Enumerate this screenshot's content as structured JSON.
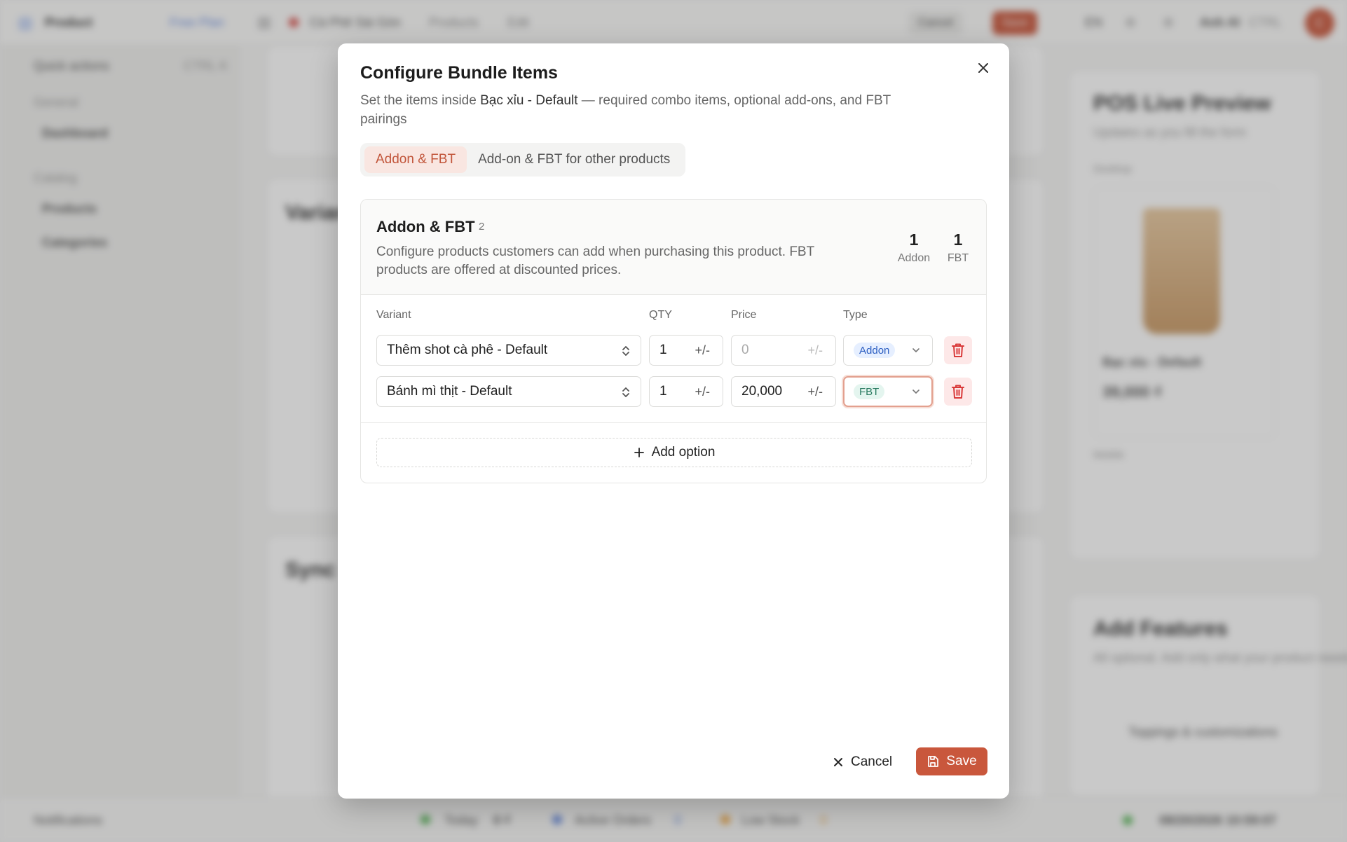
{
  "background": {
    "app_name": "Product",
    "plan_label": "Free Plan",
    "quick_actions": "Quick actions",
    "quick_shortcut": "CTRL K",
    "nav_section_general": "General",
    "nav_dashboard": "Dashboard",
    "nav_section_catalog": "Catalog",
    "nav_products": "Products",
    "nav_categories": "Categories",
    "breadcrumb_store": "Cà Phê Sài Gòn",
    "breadcrumb_products": "Products",
    "breadcrumb_edit": "Edit",
    "cancel_label": "Cancel",
    "save_label": "Save",
    "lang_label": "EN",
    "user_label": "Anh Al",
    "user_shortcut": "CTRL",
    "avatar_initial": "C",
    "variants_title": "Variants",
    "sync_title": "Sync",
    "preview_title": "POS Live Preview",
    "preview_subtitle": "Updates as you fill the form",
    "preview_desktop": "Desktop",
    "preview_item_name": "Bạc xỉu - Default",
    "preview_item_price": "39,000 ₫",
    "preview_mobile": "Mobile",
    "add_features_title": "Add Features",
    "add_features_desc": "All optional. Add only what your product needs.",
    "feature_toppings": "Toppings & customizations",
    "notifications": "Notifications",
    "footer_today": "Today",
    "footer_today_value": "0 ₫",
    "footer_active_orders": "Active Orders",
    "footer_active_value": "0",
    "footer_low_stock": "Low Stock",
    "footer_low_value": "0",
    "footer_datetime": "08/20/2026 10:59:07"
  },
  "modal": {
    "title": "Configure Bundle Items",
    "description_prefix": "Set the items inside ",
    "description_product": "Bạc xỉu - Default",
    "description_suffix": " — required combo items, optional add-ons, and FBT pairings",
    "tabs": [
      {
        "label": "Addon & FBT",
        "active": true
      },
      {
        "label": "Add-on & FBT for other products",
        "active": false
      }
    ],
    "panel": {
      "title": "Addon & FBT",
      "count": "2",
      "description": "Configure products customers can add when purchasing this product. FBT products are offered at discounted prices.",
      "stats": [
        {
          "value": "1",
          "label": "Addon"
        },
        {
          "value": "1",
          "label": "FBT"
        }
      ],
      "columns": [
        "Variant",
        "QTY",
        "Price",
        "Type"
      ],
      "rows": [
        {
          "variant": "Thêm shot cà phê - Default",
          "qty": "1",
          "qty_suffix": "+/-",
          "price": "",
          "price_placeholder": "0",
          "price_suffix": "+/-",
          "type": "Addon"
        },
        {
          "variant": "Bánh mì thịt - Default",
          "qty": "1",
          "qty_suffix": "+/-",
          "price": "20,000",
          "price_placeholder": "0",
          "price_suffix": "+/-",
          "type": "FBT"
        }
      ],
      "add_option_label": "Add option"
    },
    "cancel_label": "Cancel",
    "save_label": "Save"
  },
  "colors": {
    "accent": "#c9573c",
    "addon_badge": "#2d5fc2",
    "fbt_badge": "#2a7b61",
    "delete": "#d93a3a"
  },
  "icons": [
    "close-icon",
    "chevron-up-down-icon",
    "chevron-down-icon",
    "trash-icon",
    "plus-icon",
    "x-icon",
    "save-icon"
  ]
}
